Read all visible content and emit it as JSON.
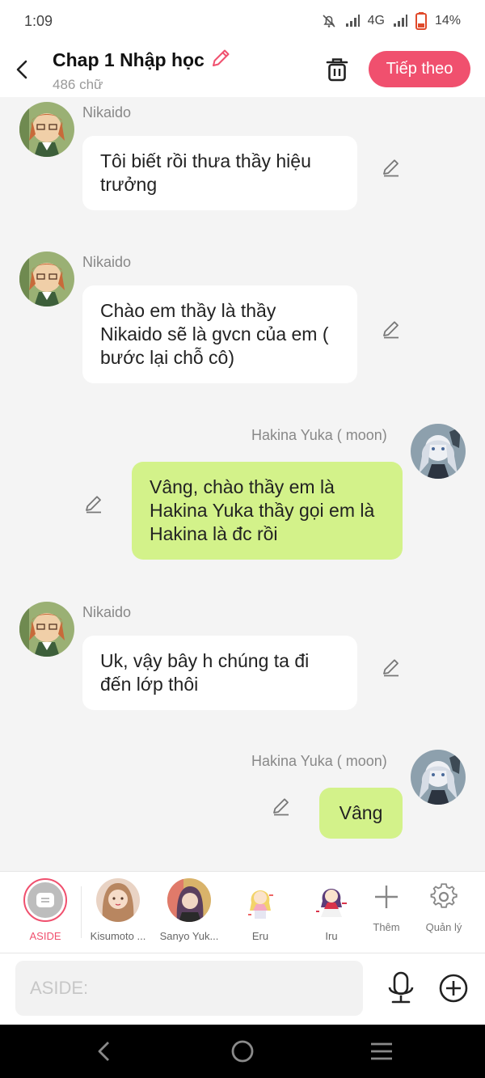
{
  "status": {
    "time": "1:09",
    "network": "4G",
    "battery": "14%"
  },
  "header": {
    "title": "Chap 1 Nhập học",
    "subtitle": "486 chữ",
    "next_label": "Tiếp theo"
  },
  "messages": [
    {
      "side": "left",
      "sender": "Nikaido",
      "text": "Tôi biết rồi thưa thầy hiệu trưởng"
    },
    {
      "side": "left",
      "sender": "Nikaido",
      "text": "Chào em thầy là thầy Nikaido sẽ là gvcn của em ( bước lại chỗ cô)"
    },
    {
      "side": "right",
      "sender": "Hakina Yuka ( moon)",
      "text": "Vâng, chào thầy em là Hakina Yuka thầy gọi em là Hakina là đc rồi"
    },
    {
      "side": "left",
      "sender": "Nikaido",
      "text": "Uk, vậy bây h chúng ta đi đến lớp thôi"
    },
    {
      "side": "right",
      "sender": "Hakina Yuka ( moon)",
      "text": "Vâng"
    }
  ],
  "characters": [
    {
      "label": "ASIDE"
    },
    {
      "label": "Kisumoto ..."
    },
    {
      "label": "Sanyo Yuk..."
    },
    {
      "label": "Eru"
    },
    {
      "label": "Iru"
    }
  ],
  "tools": {
    "add_label": "Thêm",
    "manage_label": "Quản lý"
  },
  "input": {
    "placeholder": "ASIDE:"
  },
  "colors": {
    "accent": "#f0506e",
    "right_bubble": "#d3f28a",
    "left_bubble": "#ffffff",
    "background": "#f4f4f4"
  }
}
